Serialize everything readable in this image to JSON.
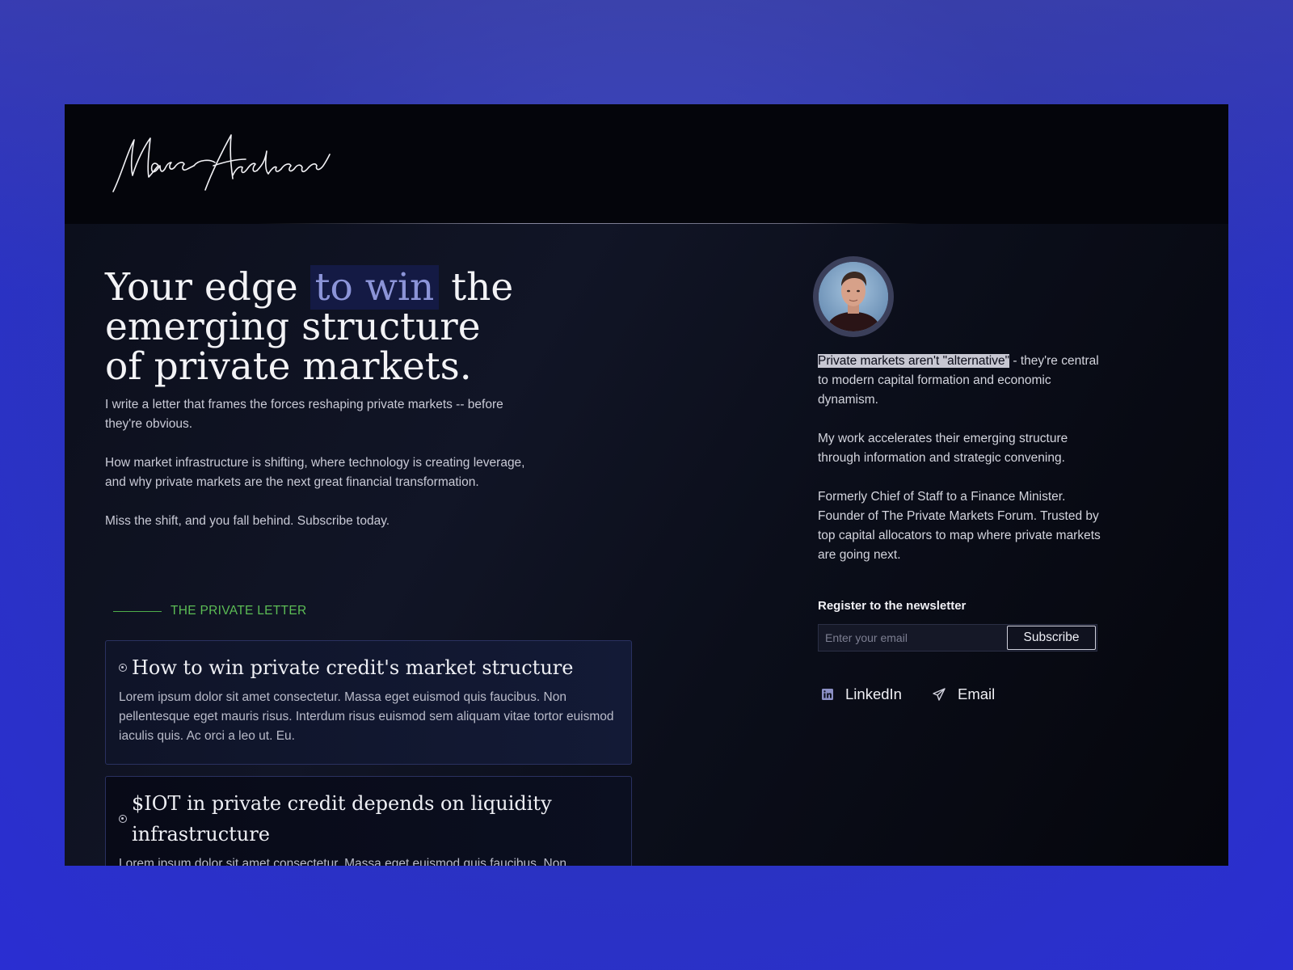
{
  "brand": {
    "signature": "Marc Andrew"
  },
  "hero": {
    "title_before": "Your edge ",
    "title_highlight": "to win",
    "title_after": " the emerging structure of private markets.",
    "paragraphs": [
      "I write a letter that frames the forces reshaping private markets -- before they're obvious.",
      "How market infrastructure is shifting, where technology is creating leverage, and why private markets are the next great financial transformation.",
      "Miss the shift, and you fall behind. Subscribe today."
    ]
  },
  "letter": {
    "section_label": "THE PRIVATE LETTER",
    "posts": [
      {
        "title": "How to win private credit's market structure",
        "excerpt": "Lorem ipsum dolor sit amet consectetur. Massa eget euismod quis faucibus. Non pellentesque eget mauris risus. Interdum risus euismod sem aliquam vitae tortor euismod iaculis quis. Ac orci a leo ut. Eu."
      },
      {
        "title": "$IOT in private credit depends on liquidity infrastructure",
        "excerpt": "Lorem ipsum dolor sit amet consectetur. Massa eget euismod quis faucibus. Non"
      }
    ]
  },
  "bio": {
    "highlight": "Private markets aren't \"alternative\"",
    "p1_rest": " - they're central to modern capital formation and economic dynamism.",
    "p2": "My work accelerates their emerging structure through information and strategic convening.",
    "p3": "Formerly Chief of Staff to a Finance Minister. Founder of The Private Markets Forum. Trusted by top capital allocators to map where private markets are going next."
  },
  "newsletter": {
    "label": "Register to the newsletter",
    "placeholder": "Enter your email",
    "button": "Subscribe"
  },
  "social": [
    {
      "label": "LinkedIn",
      "icon": "linkedin-icon"
    },
    {
      "label": "Email",
      "icon": "paper-plane-icon"
    }
  ],
  "colors": {
    "background": "#2b35b8",
    "panel": "#05060c",
    "accent_highlight": "#8c94d8",
    "section_green": "#5cbd55"
  }
}
